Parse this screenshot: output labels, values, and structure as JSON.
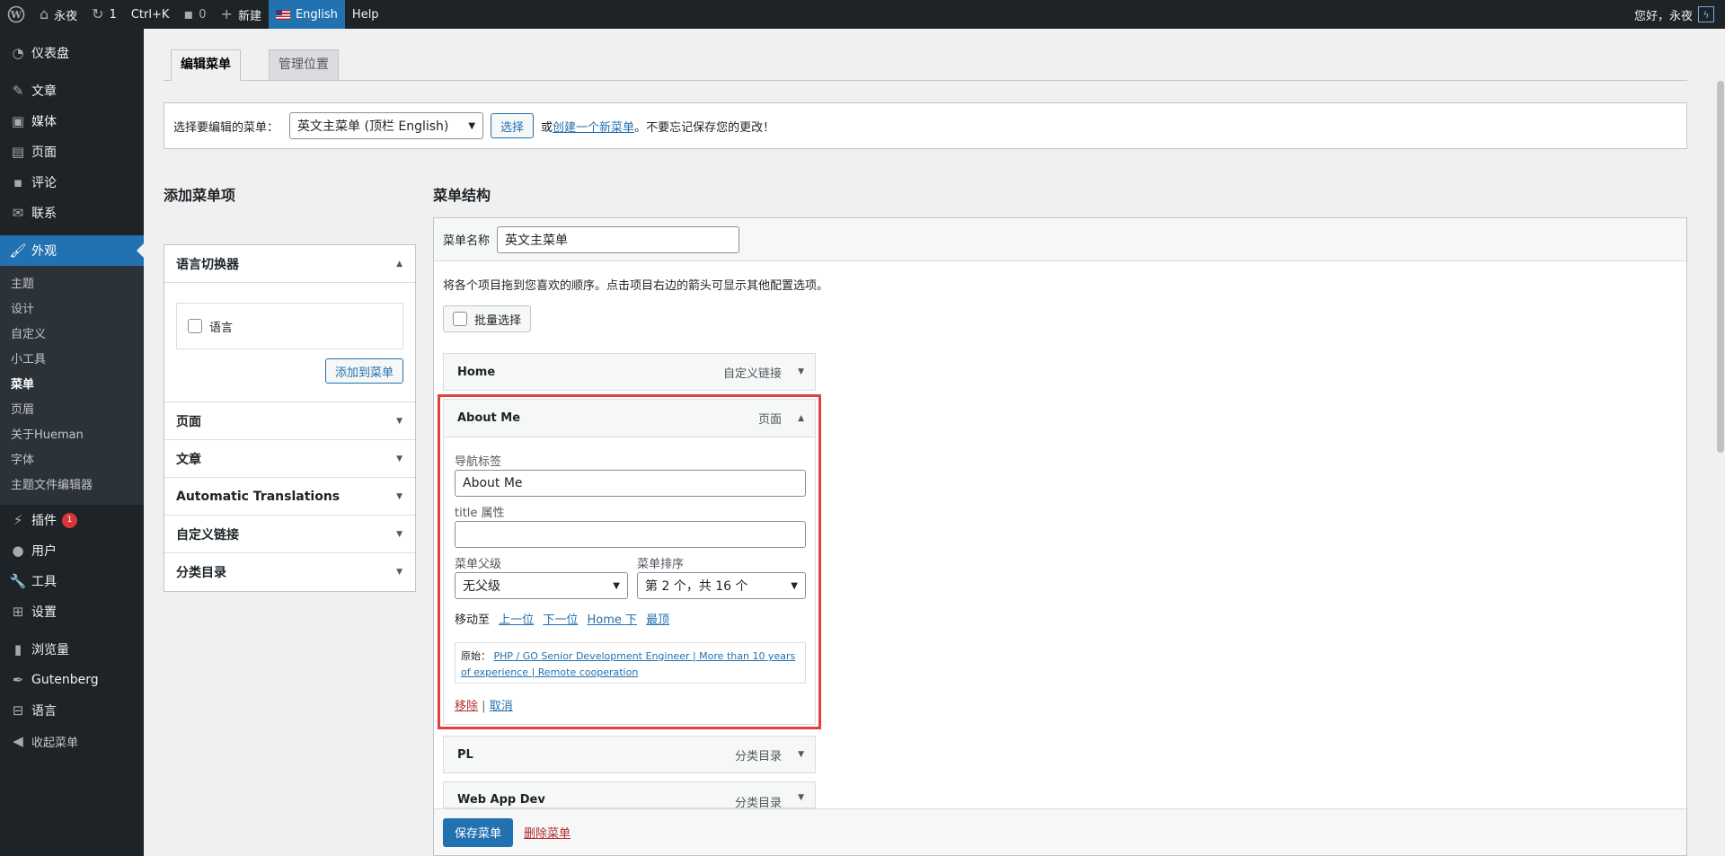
{
  "adminbar": {
    "site_name": "永夜",
    "updates_count": "1",
    "shortcut": "Ctrl+K",
    "comments_count": "0",
    "new_label": "新建",
    "language": "English",
    "help": "Help",
    "greeting": "您好，永夜"
  },
  "sidebar": {
    "dashboard": "仪表盘",
    "posts": "文章",
    "media": "媒体",
    "pages": "页面",
    "comments": "评论",
    "contact": "联系",
    "appearance": "外观",
    "submenu": [
      "主题",
      "设计",
      "自定义",
      "小工具",
      "菜单",
      "页眉",
      "关于Hueman",
      "字体",
      "主题文件编辑器"
    ],
    "plugins": "插件",
    "plugins_badge": "1",
    "users": "用户",
    "tools": "工具",
    "settings": "设置",
    "views": "浏览量",
    "gutenberg": "Gutenberg",
    "languages": "语言",
    "collapse": "收起菜单"
  },
  "tabs": {
    "edit": "编辑菜单",
    "locations": "管理位置"
  },
  "manage": {
    "label": "选择要编辑的菜单：",
    "selected_menu": "英文主菜单 (顶栏 English)",
    "select_button": "选择",
    "or_text": "或",
    "create_link": "创建一个新菜单",
    "tail_text": "。不要忘记保存您的更改！"
  },
  "left": {
    "title": "添加菜单项",
    "lang_switcher": "语言切换器",
    "lang_checkbox": "语言",
    "add_button": "添加到菜单",
    "sections": [
      "页面",
      "文章",
      "Automatic Translations",
      "自定义链接",
      "分类目录"
    ]
  },
  "right": {
    "title": "菜单结构",
    "name_label": "菜单名称",
    "name_value": "英文主菜单",
    "description": "将各个项目拖到您喜欢的顺序。点击项目右边的箭头可显示其他配置选项。",
    "bulk_select": "批量选择",
    "items": [
      {
        "title": "Home",
        "type": "自定义链接"
      },
      {
        "title": "About Me",
        "type": "页面"
      },
      {
        "title": "PL",
        "type": "分类目录"
      },
      {
        "title": "Web App Dev",
        "type": "分类目录"
      }
    ],
    "open_item": {
      "nav_label": "导航标签",
      "nav_value": "About Me",
      "title_attr_label": "title 属性",
      "title_attr_value": "",
      "parent_label": "菜单父级",
      "parent_value": "无父级",
      "order_label": "菜单排序",
      "order_value": "第 2 个，共 16 个",
      "move_label": "移动至",
      "move_up": "上一位",
      "move_down": "下一位",
      "move_under": "Home 下",
      "move_top": "最顶",
      "original_label": "原始：",
      "original_link": "PHP / GO Senior Development Engineer | More than 10 years of experience | Remote cooperation",
      "remove": "移除",
      "separator": "|",
      "cancel": "取消"
    },
    "save_button": "保存菜单",
    "delete_link": "删除菜单"
  },
  "colors": {
    "accent": "#2271b1",
    "highlight": "#e04141",
    "sidebar_bg": "#1d2327"
  }
}
